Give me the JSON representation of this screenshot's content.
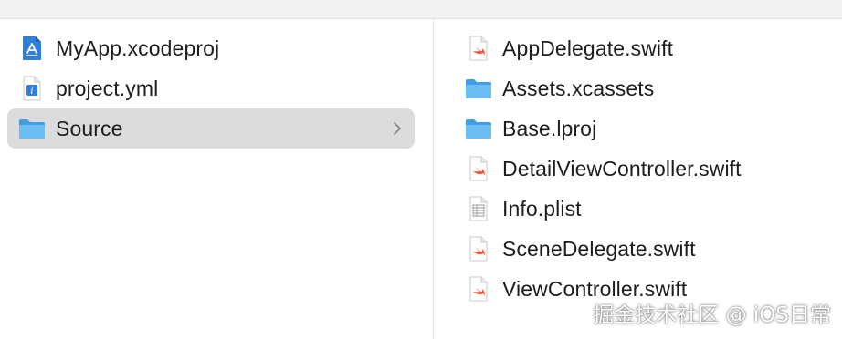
{
  "colors": {
    "selected_row_bg": "#dcdcdc",
    "folder_blue": "#5fb4ee",
    "swift_orange": "#f05138",
    "label_text": "#1d1d1f"
  },
  "left_column": {
    "items": [
      {
        "label": "MyApp.xcodeproj",
        "icon": "xcode-project-icon",
        "selected": false
      },
      {
        "label": "project.yml",
        "icon": "yml-file-icon",
        "selected": false
      },
      {
        "label": "Source",
        "icon": "folder-icon",
        "selected": true,
        "has_children": true
      }
    ]
  },
  "right_column": {
    "items": [
      {
        "label": "AppDelegate.swift",
        "icon": "swift-file-icon"
      },
      {
        "label": "Assets.xcassets",
        "icon": "folder-icon"
      },
      {
        "label": "Base.lproj",
        "icon": "folder-icon"
      },
      {
        "label": "DetailViewController.swift",
        "icon": "swift-file-icon"
      },
      {
        "label": "Info.plist",
        "icon": "plist-file-icon"
      },
      {
        "label": "SceneDelegate.swift",
        "icon": "swift-file-icon"
      },
      {
        "label": "ViewController.swift",
        "icon": "swift-file-icon"
      }
    ]
  },
  "watermark": "掘金技术社区 @ iOS日常"
}
